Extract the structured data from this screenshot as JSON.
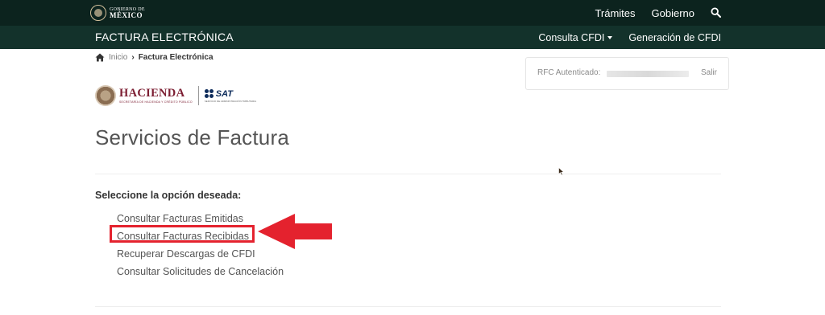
{
  "topbar": {
    "logo_small": "GOBIERNO DE",
    "logo_big": "MÉXICO",
    "links": [
      "Trámites",
      "Gobierno"
    ],
    "search_icon": "search-icon"
  },
  "subbar": {
    "brand": "FACTURA ELECTRÓNICA",
    "nav": {
      "consulta": "Consulta CFDI",
      "generacion": "Generación de CFDI"
    }
  },
  "breadcrumb": {
    "home_icon": "home-icon",
    "items": [
      "Inicio",
      "Factura Electrónica"
    ]
  },
  "rfc": {
    "label": "RFC Autenticado:",
    "logout": "Salir"
  },
  "logos": {
    "hacienda": "HACIENDA",
    "hacienda_sub": "SECRETARÍA DE HACIENDA Y CRÉDITO PÚBLICO",
    "sat": "SAT",
    "sat_sub": "SERVICIO DE ADMINISTRACIÓN TRIBUTARIA"
  },
  "main": {
    "title": "Servicios de Factura",
    "prompt": "Seleccione la opción deseada:",
    "options": [
      "Consultar Facturas Emitidas",
      "Consultar Facturas Recibidas",
      "Recuperar Descargas de CFDI",
      "Consultar Solicitudes de Cancelación"
    ],
    "highlighted_index": 1
  },
  "colors": {
    "topbar": "#0c231e",
    "subbar": "#13322b",
    "highlight": "#e4222e",
    "hacienda": "#7c1e32",
    "sat": "#0f2d5c"
  }
}
